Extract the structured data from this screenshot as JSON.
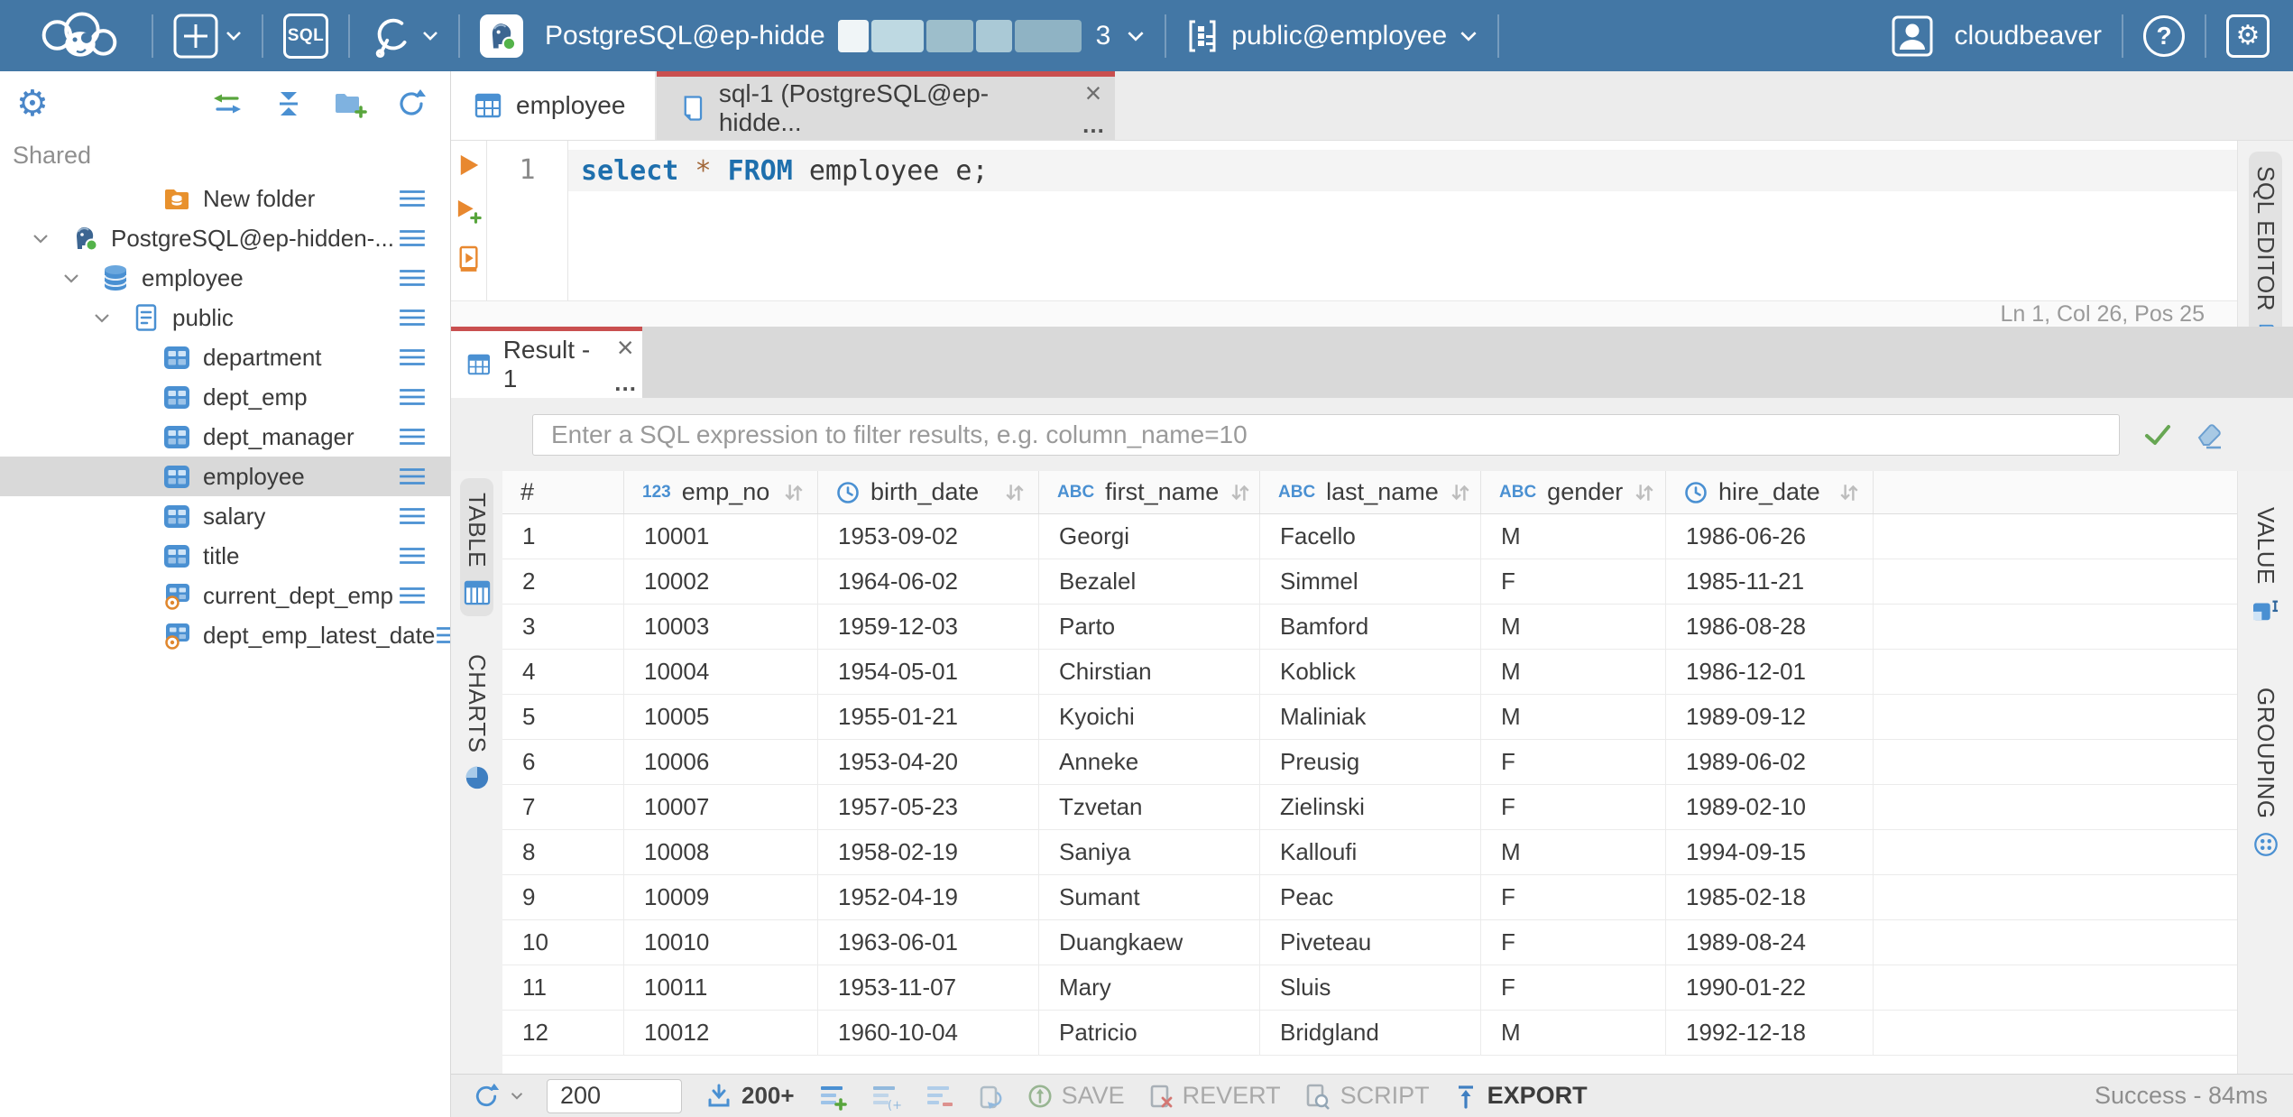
{
  "colors": {
    "topbar": "#4377a5",
    "accent_red": "#c94f4f",
    "icon_blue": "#4a90d2",
    "success_green": "#67a653",
    "run_orange": "#e8882f"
  },
  "topbar": {
    "sql_button": "SQL",
    "connection": {
      "name": "PostgreSQL@ep-hidde",
      "redacted": true,
      "suffix": "3"
    },
    "schema_selector": "public@employee",
    "user": "cloudbeaver",
    "icons": [
      "cloudbeaver-logo",
      "new-object",
      "sql-editor",
      "driver-manager",
      "postgres-connection",
      "schema",
      "user",
      "help",
      "settings"
    ]
  },
  "sidebar": {
    "section_label": "Shared",
    "toolbar_icons": [
      "settings-gear",
      "sync-with-editor",
      "collapse-all",
      "new-folder",
      "refresh"
    ],
    "items": [
      {
        "label": "New folder",
        "icon": "folder-db",
        "depth": 3,
        "chevron": false,
        "selected": false,
        "menu": false
      },
      {
        "label": "PostgreSQL@ep-hidden-...",
        "icon": "postgres",
        "depth": 0,
        "chevron": true,
        "selected": false,
        "menu": false
      },
      {
        "label": "employee",
        "icon": "database",
        "depth": 1,
        "chevron": true,
        "selected": false,
        "menu": false
      },
      {
        "label": "public",
        "icon": "schema",
        "depth": 2,
        "chevron": true,
        "selected": false,
        "menu": false
      },
      {
        "label": "department",
        "icon": "table",
        "depth": 3,
        "chevron": false,
        "selected": false,
        "menu": false
      },
      {
        "label": "dept_emp",
        "icon": "table",
        "depth": 3,
        "chevron": false,
        "selected": false,
        "menu": false
      },
      {
        "label": "dept_manager",
        "icon": "table",
        "depth": 3,
        "chevron": false,
        "selected": false,
        "menu": false
      },
      {
        "label": "employee",
        "icon": "table",
        "depth": 3,
        "chevron": false,
        "selected": true,
        "menu": true
      },
      {
        "label": "salary",
        "icon": "table",
        "depth": 3,
        "chevron": false,
        "selected": false,
        "menu": false
      },
      {
        "label": "title",
        "icon": "table",
        "depth": 3,
        "chevron": false,
        "selected": false,
        "menu": false
      },
      {
        "label": "current_dept_emp",
        "icon": "view",
        "depth": 3,
        "chevron": false,
        "selected": false,
        "menu": false
      },
      {
        "label": "dept_emp_latest_date",
        "icon": "view",
        "depth": 3,
        "chevron": false,
        "selected": false,
        "menu": false
      }
    ]
  },
  "editor_tabs": {
    "tab1": {
      "label": "employee"
    },
    "tab2": {
      "label": "sql-1 (PostgreSQL@ep-hidde...",
      "close": "×",
      "more": "…"
    }
  },
  "sql_editor": {
    "line_number": "1",
    "tokens": [
      {
        "t": "select",
        "c": "kw"
      },
      {
        "t": " ",
        "c": "p"
      },
      {
        "t": "*",
        "c": "op"
      },
      {
        "t": " ",
        "c": "p"
      },
      {
        "t": "FROM",
        "c": "kw"
      },
      {
        "t": " employee e;",
        "c": "p"
      }
    ],
    "status": "Ln 1, Col 26, Pos 25"
  },
  "right_rail": {
    "sql_editor_tab": "SQL EDITOR",
    "value_tab": "VALUE",
    "grouping_tab": "GROUPING"
  },
  "result": {
    "tab_label": "Result - 1",
    "close": "×",
    "more": "…",
    "filter_placeholder": "Enter a SQL expression to filter results, e.g. column_name=10",
    "table_tab": "TABLE",
    "charts_tab": "CHARTS"
  },
  "grid": {
    "columns": [
      {
        "label": "#",
        "badge": "",
        "clock": false,
        "sort": false
      },
      {
        "label": "emp_no",
        "badge": "123",
        "clock": false,
        "sort": true
      },
      {
        "label": "birth_date",
        "badge": "",
        "clock": true,
        "sort": true
      },
      {
        "label": "first_name",
        "badge": "ABC",
        "clock": false,
        "sort": true
      },
      {
        "label": "last_name",
        "badge": "ABC",
        "clock": false,
        "sort": true
      },
      {
        "label": "gender",
        "badge": "ABC",
        "clock": false,
        "sort": true
      },
      {
        "label": "hire_date",
        "badge": "",
        "clock": true,
        "sort": true
      }
    ],
    "rows": [
      [
        "1",
        "10001",
        "1953-09-02",
        "Georgi",
        "Facello",
        "M",
        "1986-06-26"
      ],
      [
        "2",
        "10002",
        "1964-06-02",
        "Bezalel",
        "Simmel",
        "F",
        "1985-11-21"
      ],
      [
        "3",
        "10003",
        "1959-12-03",
        "Parto",
        "Bamford",
        "M",
        "1986-08-28"
      ],
      [
        "4",
        "10004",
        "1954-05-01",
        "Chirstian",
        "Koblick",
        "M",
        "1986-12-01"
      ],
      [
        "5",
        "10005",
        "1955-01-21",
        "Kyoichi",
        "Maliniak",
        "M",
        "1989-09-12"
      ],
      [
        "6",
        "10006",
        "1953-04-20",
        "Anneke",
        "Preusig",
        "F",
        "1989-06-02"
      ],
      [
        "7",
        "10007",
        "1957-05-23",
        "Tzvetan",
        "Zielinski",
        "F",
        "1989-02-10"
      ],
      [
        "8",
        "10008",
        "1958-02-19",
        "Saniya",
        "Kalloufi",
        "M",
        "1994-09-15"
      ],
      [
        "9",
        "10009",
        "1952-04-19",
        "Sumant",
        "Peac",
        "F",
        "1985-02-18"
      ],
      [
        "10",
        "10010",
        "1963-06-01",
        "Duangkaew",
        "Piveteau",
        "F",
        "1989-08-24"
      ],
      [
        "11",
        "10011",
        "1953-11-07",
        "Mary",
        "Sluis",
        "F",
        "1990-01-22"
      ],
      [
        "12",
        "10012",
        "1960-10-04",
        "Patricio",
        "Bridgland",
        "M",
        "1992-12-18"
      ]
    ]
  },
  "bottom_toolbar": {
    "row_limit": "200",
    "fetch_more": "200+",
    "save": "SAVE",
    "revert": "REVERT",
    "script": "SCRIPT",
    "export": "EXPORT",
    "status": "Success - 84ms"
  }
}
